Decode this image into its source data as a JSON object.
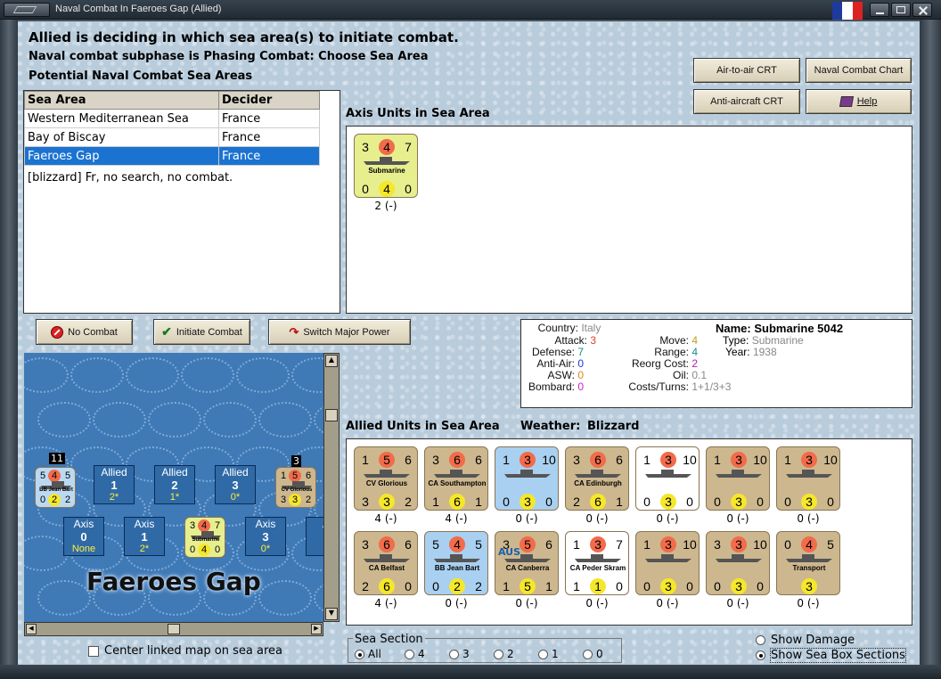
{
  "window": {
    "title": "Naval Combat In Faeroes Gap (Allied)"
  },
  "header": {
    "line1": "Allied is deciding in which sea area(s) to initiate combat.",
    "line2": "Naval combat subphase is Phasing Combat: Choose Sea Area",
    "line3": "Potential Naval Combat Sea Areas"
  },
  "right_buttons": {
    "air": "Air-to-air CRT",
    "naval": "Naval Combat Chart",
    "aa": "Anti-aircraft CRT",
    "help": "Help"
  },
  "sea_table": {
    "headers": [
      "Sea Area",
      "Decider"
    ],
    "rows": [
      {
        "area": "Western Mediterranean Sea",
        "decider": "France"
      },
      {
        "area": "Bay of Biscay",
        "decider": "France"
      },
      {
        "area": "Faeroes Gap",
        "decider": "France"
      }
    ],
    "note": "[blizzard]  Fr, no search, no combat."
  },
  "axis_section": {
    "title": "Axis Units in Sea Area",
    "units": [
      {
        "top": [
          "3",
          "4",
          "7"
        ],
        "name": "Submarine",
        "bottom": [
          "0",
          "4",
          "0"
        ],
        "under": "2 (-)"
      }
    ]
  },
  "action_buttons": {
    "no_combat": "No Combat",
    "initiate": "Initiate Combat",
    "switch": "Switch Major Power"
  },
  "info": {
    "country_k": "Country:",
    "country": "Italy",
    "attack_k": "Attack:",
    "attack": "3",
    "defense_k": "Defense:",
    "defense": "7",
    "aa_k": "Anti-Air:",
    "aa": "0",
    "asw_k": "ASW:",
    "asw": "0",
    "bombard_k": "Bombard:",
    "bombard": "0",
    "move_k": "Move:",
    "move": "4",
    "range_k": "Range:",
    "range": "4",
    "reorg_k": "Reorg Cost:",
    "reorg": "2",
    "oil_k": "Oil:",
    "oil": "0.1",
    "costs_k": "Costs/Turns:",
    "costs": "1+1/3+3",
    "name_k": "Name:",
    "name": "Submarine 5042",
    "type_k": "Type:",
    "type": "Submarine",
    "year_k": "Year:",
    "year": "1938"
  },
  "allied_section": {
    "title": "Allied Units in Sea Area",
    "weather_label": "Weather:",
    "weather": "Blizzard",
    "row1": [
      {
        "top": [
          "1",
          "5",
          "6"
        ],
        "name": "CV Glorious",
        "bottom": [
          "3",
          "3",
          "2"
        ],
        "under": "4 (-)"
      },
      {
        "top": [
          "3",
          "6",
          "6"
        ],
        "name": "CA Southampton",
        "bottom": [
          "1",
          "6",
          "1"
        ],
        "under": "4 (-)"
      },
      {
        "top": [
          "1",
          "3",
          "10"
        ],
        "name": "",
        "bottom": [
          "0",
          "3",
          "0"
        ],
        "under": "0 (-)"
      },
      {
        "top": [
          "3",
          "6",
          "6"
        ],
        "name": "CA Edinburgh",
        "bottom": [
          "2",
          "6",
          "1"
        ],
        "under": "0 (-)"
      },
      {
        "top": [
          "1",
          "3",
          "10"
        ],
        "name": "",
        "bottom": [
          "0",
          "3",
          "0"
        ],
        "under": "0 (-)"
      },
      {
        "top": [
          "1",
          "3",
          "10"
        ],
        "name": "",
        "bottom": [
          "0",
          "3",
          "0"
        ],
        "under": "0 (-)"
      },
      {
        "top": [
          "1",
          "3",
          "10"
        ],
        "name": "",
        "bottom": [
          "0",
          "3",
          "0"
        ],
        "under": "0 (-)"
      }
    ],
    "row2": [
      {
        "top": [
          "3",
          "6",
          "6"
        ],
        "name": "CA Belfast",
        "bottom": [
          "2",
          "6",
          "0"
        ],
        "under": "4 (-)"
      },
      {
        "top": [
          "5",
          "4",
          "5"
        ],
        "name": "BB Jean Bart",
        "bottom": [
          "0",
          "2",
          "2"
        ],
        "under": "0 (-)"
      },
      {
        "top": [
          "3",
          "5",
          "6"
        ],
        "name": "CA Canberra",
        "bottom": [
          "1",
          "5",
          "1"
        ],
        "under": "0 (-)"
      },
      {
        "top": [
          "1",
          "3",
          "7"
        ],
        "name": "CA Peder Skram",
        "bottom": [
          "1",
          "1",
          "0"
        ],
        "under": "0 (-)"
      },
      {
        "top": [
          "1",
          "3",
          "10"
        ],
        "name": "",
        "bottom": [
          "0",
          "3",
          "0"
        ],
        "under": "0 (-)"
      },
      {
        "top": [
          "3",
          "3",
          "10"
        ],
        "name": "",
        "bottom": [
          "0",
          "3",
          "0"
        ],
        "under": "0 (-)"
      },
      {
        "top": [
          "0",
          "4",
          "5"
        ],
        "name": "Transport",
        "bottom": [
          "",
          "3",
          ""
        ],
        "under": "0 (-)"
      }
    ],
    "aus_label": "AUS"
  },
  "map": {
    "name": "Faeroes Gap",
    "allied_boxes": [
      {
        "label": "Allied",
        "num": "1",
        "val": "2*"
      },
      {
        "label": "Allied",
        "num": "2",
        "val": "1*"
      },
      {
        "label": "Allied",
        "num": "3",
        "val": "0*"
      }
    ],
    "axis_boxes": [
      {
        "label": "Axis",
        "num": "0",
        "val": "None"
      },
      {
        "label": "Axis",
        "num": "1",
        "val": "2*"
      },
      {
        "label": "Axis",
        "num": "3",
        "val": "0*"
      },
      {
        "label": "A",
        "num": "",
        "val": ""
      }
    ],
    "bb_counter": {
      "top": [
        "5",
        "4",
        "5"
      ],
      "name": "BB Jean Bart",
      "bottom": [
        "0",
        "2",
        "2"
      ],
      "stack": "11"
    },
    "cv_counter": {
      "top": [
        "1",
        "5",
        "6"
      ],
      "name": "CV Glorious",
      "bottom": [
        "3",
        "3",
        "2"
      ],
      "stack": "3"
    },
    "sub_counter": {
      "top": [
        "3",
        "4",
        "7"
      ],
      "name": "Submarine",
      "bottom": [
        "0",
        "4",
        "0"
      ]
    }
  },
  "center_linked": "Center linked map on sea area",
  "sea_section": {
    "title": "Sea Section",
    "options": [
      "All",
      "4",
      "3",
      "2",
      "1",
      "0"
    ]
  },
  "show_damage": "Show Damage",
  "show_boxes": "Show Sea Box Sections",
  "colors": {
    "attack": "#f26b4a",
    "defense": "#f5e72a",
    "selection": "#1b73d1"
  }
}
